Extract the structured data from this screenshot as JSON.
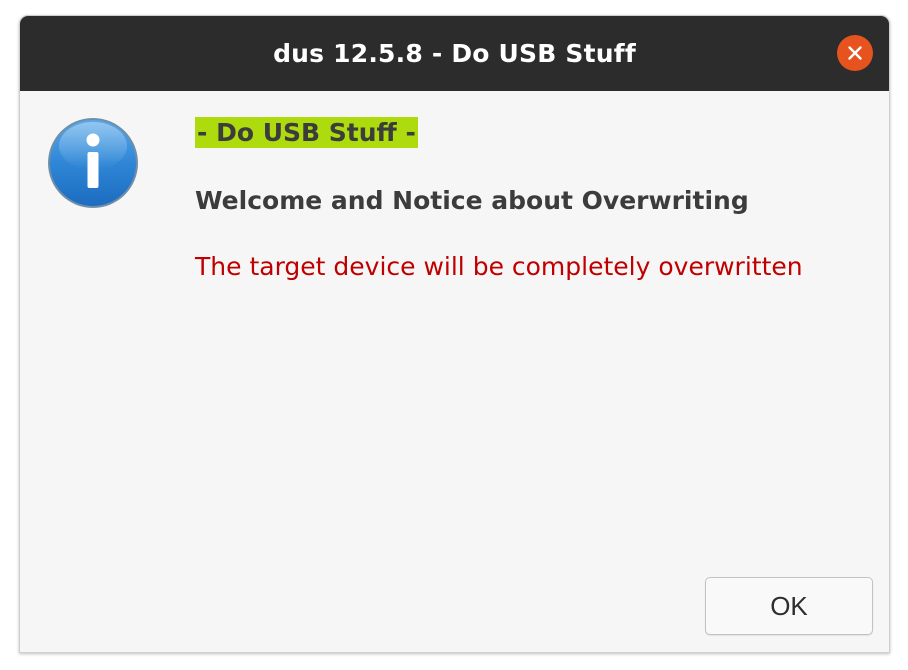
{
  "window": {
    "title": "dus 12.5.8 - Do USB Stuff"
  },
  "dialog": {
    "icon": "info-icon",
    "heading": "- Do USB Stuff -",
    "subheading": "Welcome and Notice about Overwriting",
    "warning": "The target device will be completely overwritten",
    "ok_label": "OK"
  },
  "colors": {
    "titlebar": "#2c2c2c",
    "close_button": "#e6531e",
    "heading_highlight": "#aedb0e",
    "warning_text": "#c00000",
    "body_background": "#f6f6f6"
  }
}
